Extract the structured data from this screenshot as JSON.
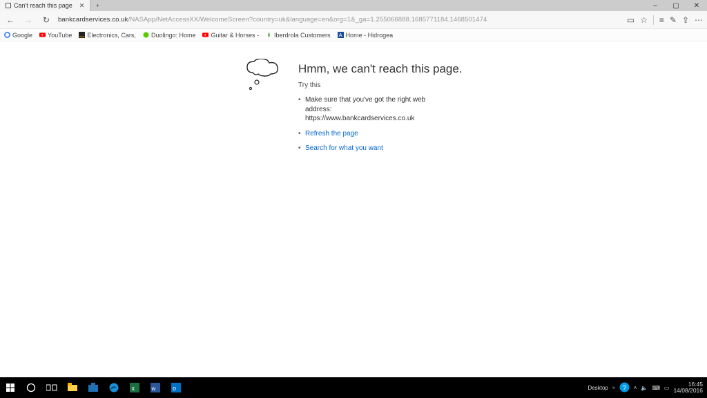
{
  "titlebar": {
    "tab_title": "Can't reach this page"
  },
  "window": {
    "min": "–",
    "max": "▢",
    "close": "✕"
  },
  "address": {
    "host": "bankcardservices.co.uk",
    "path": "/NASApp/NetAccessXX/WelcomeScreen?country=uk&language=en&org=1&_ga=1.255066888.1685771184.1468501474"
  },
  "favorites": [
    {
      "label": "Google"
    },
    {
      "label": "YouTube"
    },
    {
      "label": "Electronics, Cars,"
    },
    {
      "label": "Duolingo: Home"
    },
    {
      "label": "Guitar & Horses -"
    },
    {
      "label": "Iberdrola Customers"
    },
    {
      "label": "Home - Hidrogea"
    }
  ],
  "error": {
    "heading": "Hmm, we can't reach this page.",
    "try": "Try this",
    "line1a": "Make sure that you've got the right web address:",
    "line1b": "https://www.bankcardservices.co.uk",
    "link_refresh": "Refresh the page",
    "link_search": "Search for what you want"
  },
  "systray": {
    "desktop": "Desktop",
    "time": "16:45",
    "date": "14/08/2016"
  }
}
